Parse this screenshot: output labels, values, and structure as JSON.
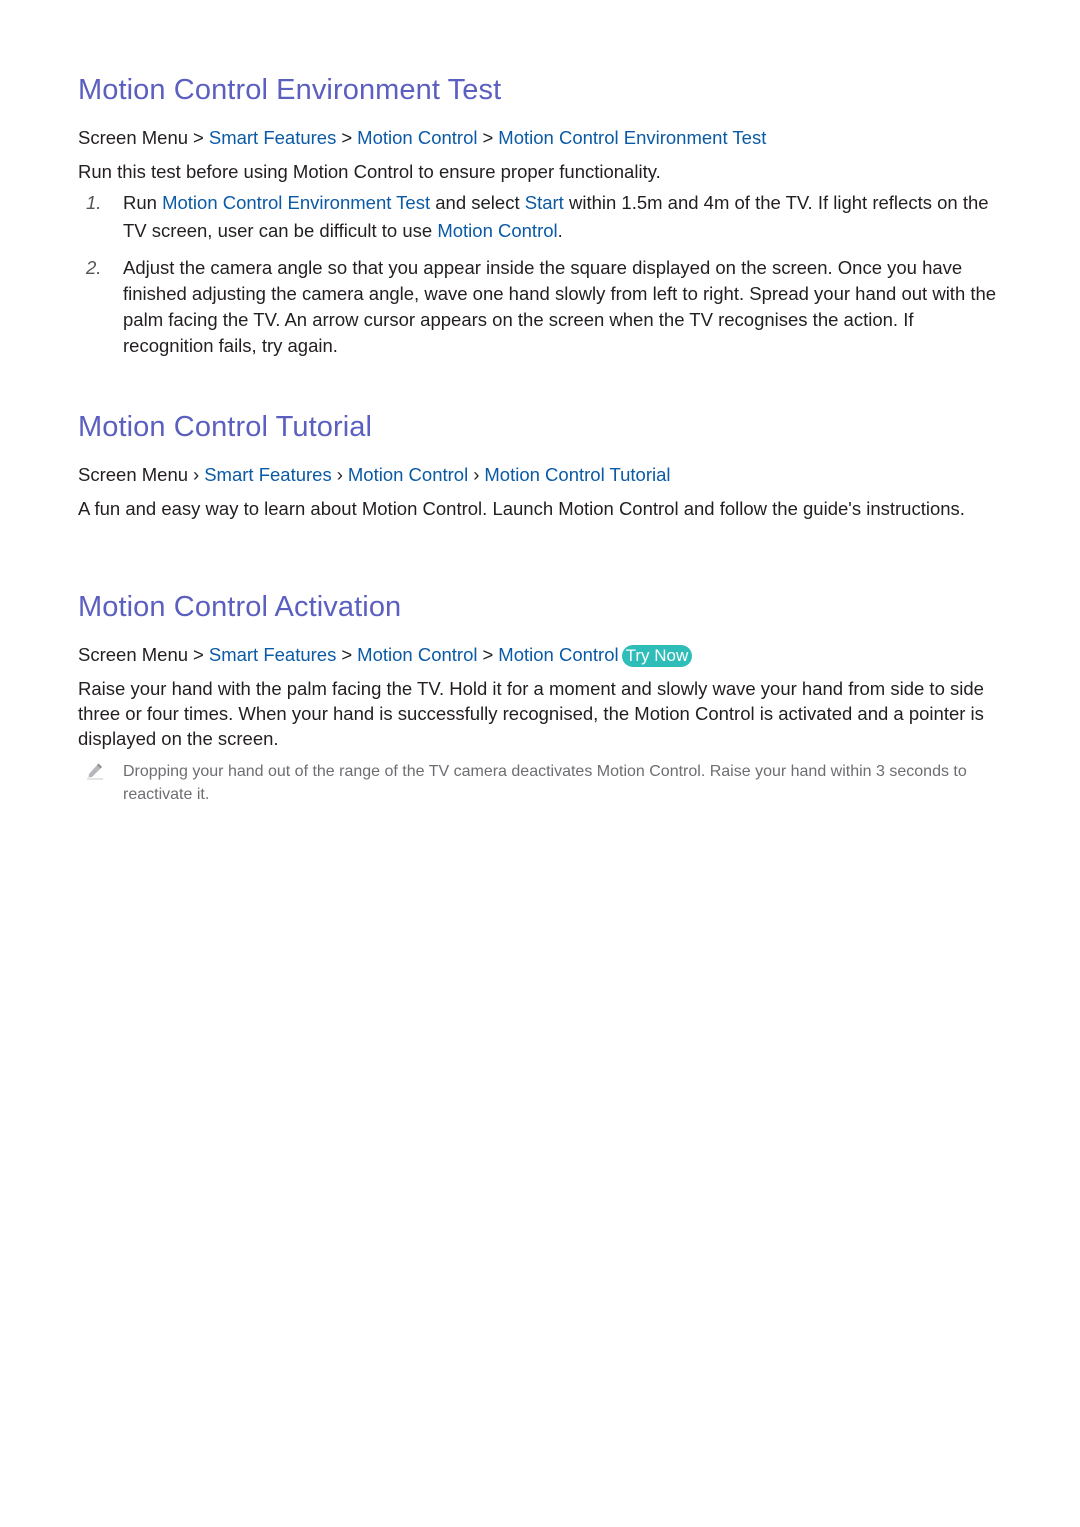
{
  "sections": [
    {
      "title": "Motion Control Environment Test",
      "breadcrumb": {
        "root": "Screen Menu",
        "separator": ">",
        "items": [
          "Smart Features",
          "Motion Control",
          "Motion Control Environment Test"
        ]
      },
      "intro": "Run this test before using Motion Control to ensure proper functionality.",
      "steps": [
        {
          "number": "1.",
          "parts": [
            {
              "text": "Run ",
              "hl": false
            },
            {
              "text": "Motion Control Environment Test",
              "hl": true
            },
            {
              "text": " and select ",
              "hl": false
            },
            {
              "text": "Start",
              "hl": true
            },
            {
              "text": " within 1.5m and 4m of the TV. If light reflects on the TV screen, user can be difficult to use ",
              "hl": false
            },
            {
              "text": "Motion Control",
              "hl": true
            },
            {
              "text": ".",
              "hl": false
            }
          ]
        },
        {
          "number": "2.",
          "parts": [
            {
              "text": "Adjust the camera angle so that you appear inside the square displayed on the screen. Once you have finished adjusting the camera angle, wave one hand slowly from left to right. Spread your hand out with the palm facing the TV. An arrow cursor appears on the screen when the TV recognises the action. If recognition fails, try again.",
              "hl": false
            }
          ]
        }
      ]
    },
    {
      "title": "Motion Control Tutorial",
      "breadcrumb": {
        "root": "Screen Menu",
        "separator": "〉",
        "items": [
          "Smart Features",
          "Motion Control",
          "Motion Control Tutorial"
        ]
      },
      "body": "A fun and easy way to learn about Motion Control. Launch Motion Control and follow the guide's instructions."
    },
    {
      "title": "Motion Control Activation",
      "breadcrumb": {
        "root": "Screen Menu",
        "separator": ">",
        "items": [
          "Smart Features",
          "Motion Control",
          "Motion Control"
        ],
        "badge": "Try Now"
      },
      "body": "Raise your hand with the palm facing the TV. Hold it for a moment and slowly wave your hand from side to side three or four times. When your hand is successfully recognised, the Motion Control is activated and a pointer is displayed on the screen.",
      "note": {
        "icon": "pencil-icon",
        "text": "Dropping your hand out of the range of the TV camera deactivates Motion Control. Raise your hand within 3 seconds to reactivate it."
      }
    }
  ],
  "colors": {
    "heading": "#5b5fbf",
    "link": "#0b5aa5",
    "badge": "#2ebdb8",
    "note_text": "#6d6e71"
  }
}
